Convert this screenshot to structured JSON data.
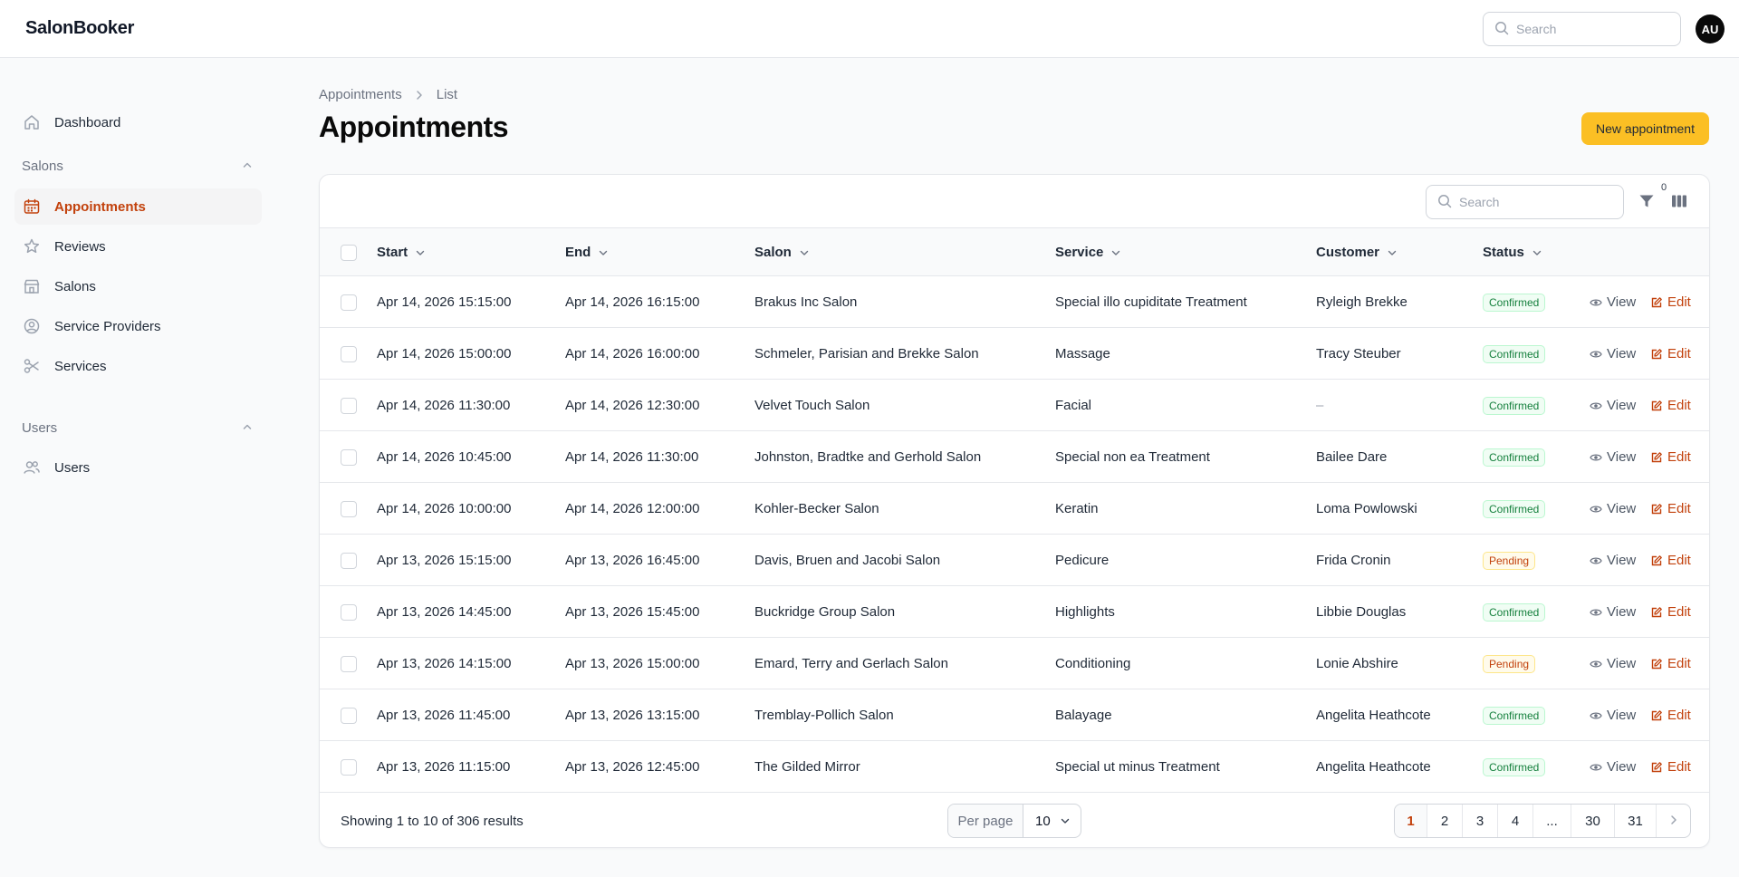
{
  "app": {
    "brand": "SalonBooker",
    "avatar_initials": "AU",
    "search_placeholder": "Search"
  },
  "sidebar": {
    "dashboard": "Dashboard",
    "groups": [
      {
        "label": "Salons",
        "items": [
          "Appointments",
          "Reviews",
          "Salons",
          "Service Providers",
          "Services"
        ]
      },
      {
        "label": "Users",
        "items": [
          "Users"
        ]
      }
    ],
    "active_item": "Appointments"
  },
  "breadcrumb": [
    "Appointments",
    "List"
  ],
  "page": {
    "title": "Appointments",
    "new_button": "New appointment"
  },
  "table": {
    "search_placeholder": "Search",
    "filter_count": "0",
    "columns": [
      "Start",
      "End",
      "Salon",
      "Service",
      "Customer",
      "Status"
    ],
    "actions": {
      "view": "View",
      "edit": "Edit"
    },
    "rows": [
      {
        "start": "Apr 14, 2026 15:15:00",
        "end": "Apr 14, 2026 16:15:00",
        "salon": "Brakus Inc Salon",
        "service": "Special illo cupiditate Treatment",
        "customer": "Ryleigh Brekke",
        "status": "Confirmed"
      },
      {
        "start": "Apr 14, 2026 15:00:00",
        "end": "Apr 14, 2026 16:00:00",
        "salon": "Schmeler, Parisian and Brekke Salon",
        "service": "Massage",
        "customer": "Tracy Steuber",
        "status": "Confirmed"
      },
      {
        "start": "Apr 14, 2026 11:30:00",
        "end": "Apr 14, 2026 12:30:00",
        "salon": "Velvet Touch Salon",
        "service": "Facial",
        "customer": "–",
        "status": "Confirmed"
      },
      {
        "start": "Apr 14, 2026 10:45:00",
        "end": "Apr 14, 2026 11:30:00",
        "salon": "Johnston, Bradtke and Gerhold Salon",
        "service": "Special non ea Treatment",
        "customer": "Bailee Dare",
        "status": "Confirmed"
      },
      {
        "start": "Apr 14, 2026 10:00:00",
        "end": "Apr 14, 2026 12:00:00",
        "salon": "Kohler-Becker Salon",
        "service": "Keratin",
        "customer": "Loma Powlowski",
        "status": "Confirmed"
      },
      {
        "start": "Apr 13, 2026 15:15:00",
        "end": "Apr 13, 2026 16:45:00",
        "salon": "Davis, Bruen and Jacobi Salon",
        "service": "Pedicure",
        "customer": "Frida Cronin",
        "status": "Pending"
      },
      {
        "start": "Apr 13, 2026 14:45:00",
        "end": "Apr 13, 2026 15:45:00",
        "salon": "Buckridge Group Salon",
        "service": "Highlights",
        "customer": "Libbie Douglas",
        "status": "Confirmed"
      },
      {
        "start": "Apr 13, 2026 14:15:00",
        "end": "Apr 13, 2026 15:00:00",
        "salon": "Emard, Terry and Gerlach Salon",
        "service": "Conditioning",
        "customer": "Lonie Abshire",
        "status": "Pending"
      },
      {
        "start": "Apr 13, 2026 11:45:00",
        "end": "Apr 13, 2026 13:15:00",
        "salon": "Tremblay-Pollich Salon",
        "service": "Balayage",
        "customer": "Angelita Heathcote",
        "status": "Confirmed"
      },
      {
        "start": "Apr 13, 2026 11:15:00",
        "end": "Apr 13, 2026 12:45:00",
        "salon": "The Gilded Mirror",
        "service": "Special ut minus Treatment",
        "customer": "Angelita Heathcote",
        "status": "Confirmed"
      }
    ],
    "footer": {
      "summary": "Showing 1 to 10 of 306 results",
      "per_page_label": "Per page",
      "per_page_value": "10",
      "pages": [
        "1",
        "2",
        "3",
        "4",
        "...",
        "30",
        "31"
      ],
      "current_page": "1"
    }
  },
  "colors": {
    "accent": "#c2410c",
    "primary_button": "#fbbf24",
    "confirmed": "#15803d",
    "pending": "#c2410c"
  }
}
